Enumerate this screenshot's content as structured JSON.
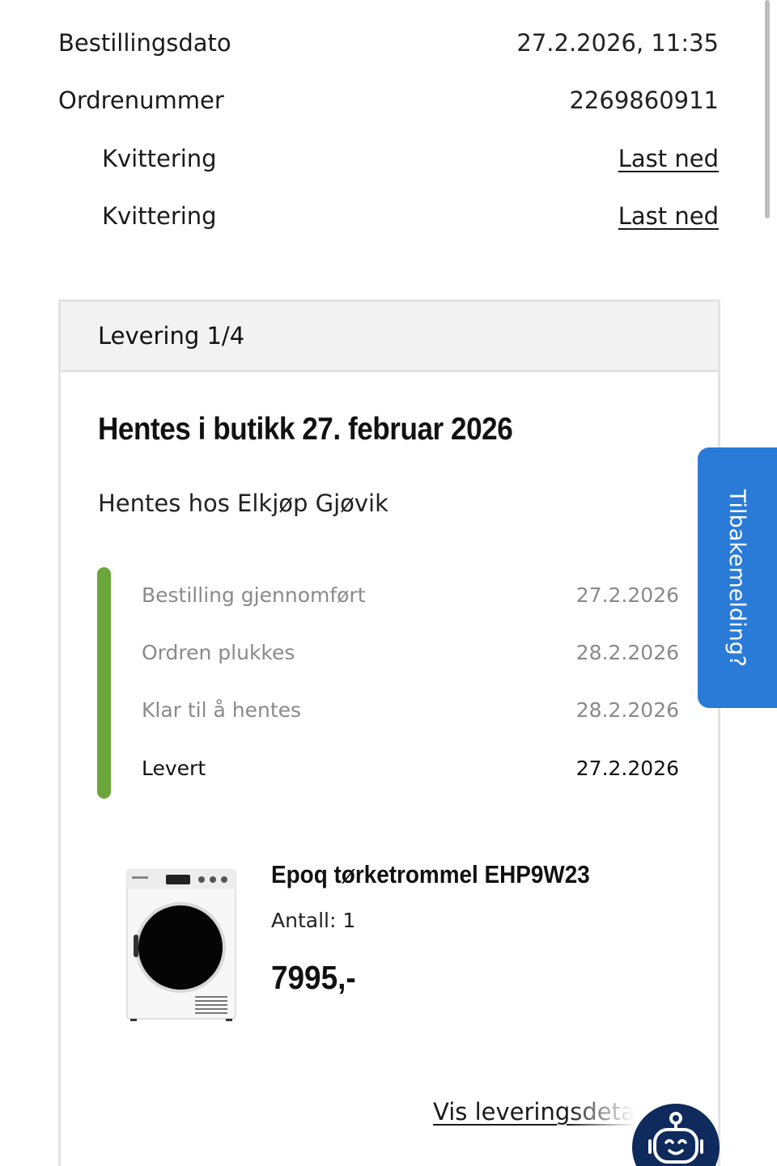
{
  "order_meta": {
    "order_date_label": "Bestillingsdato",
    "order_date_value": "27.2.2026, 11:35",
    "order_number_label": "Ordrenummer",
    "order_number_value": "2269860911",
    "receipts": [
      {
        "label": "Kvittering",
        "link": "Last ned"
      },
      {
        "label": "Kvittering",
        "link": "Last ned"
      }
    ]
  },
  "delivery": {
    "header": "Levering 1/4",
    "title": "Hentes i butikk 27. februar 2026",
    "store": "Hentes hos Elkjøp Gjøvik",
    "timeline_color": "#6aa63a",
    "steps": [
      {
        "label": "Bestilling gjennomført",
        "date": "27.2.2026"
      },
      {
        "label": "Ordren plukkes",
        "date": "28.2.2026"
      },
      {
        "label": "Klar til å hentes",
        "date": "28.2.2026"
      },
      {
        "label": "Levert",
        "date": "27.2.2026"
      }
    ],
    "product": {
      "name": "Epoq tørketrommel EHP9W23",
      "quantity": "Antall: 1",
      "price": "7995,-",
      "image_icon": "tumble-dryer-image"
    },
    "details_link": "Vis leveringsdetaljer"
  },
  "feedback_tab": {
    "label": "Tilbakemelding?",
    "color": "#2a7bd8"
  },
  "chat_button": {
    "icon": "chatbot-icon",
    "color": "#0f2a5c"
  }
}
